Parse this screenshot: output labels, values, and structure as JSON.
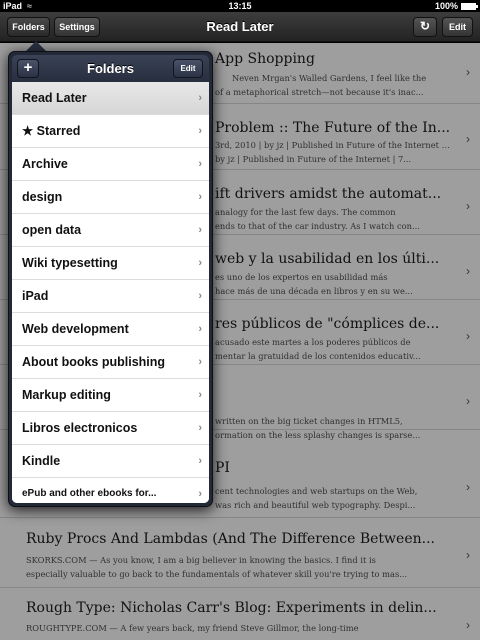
{
  "status": {
    "carrier": "iPad",
    "time": "13:15",
    "battery": "100%"
  },
  "nav": {
    "folders": "Folders",
    "settings": "Settings",
    "title": "Read Later",
    "refresh_icon": "↻",
    "edit": "Edit"
  },
  "articles": [
    {
      "title": "App Shopping",
      "line1": "Neven Mrgan's Walled Gardens, I feel like the",
      "line2": "of a metaphorical stretch—not because it's inac..."
    },
    {
      "title": "Problem :: The Future of the In...",
      "line1": "3rd, 2010 | by jz | Published in Future of the Internet | 5...",
      "line2": "by jz | Published in Future of the Internet | 7..."
    },
    {
      "title": "ift drivers amidst the automat...",
      "line1": "analogy for the last few days. The common",
      "line2": "ends to that of the car industry. As I watch con..."
    },
    {
      "title": "web y la usabilidad en los últi...",
      "line1": "es uno de los expertos en usabilidad más",
      "line2": "hace más de una década en libros y en su we..."
    },
    {
      "title": "res públicos de \"cómplices de...",
      "line1": "acusado este martes a los poderes públicos de",
      "line2": "mentar la gratuidad de los contenidos educativ..."
    },
    {
      "title": "",
      "line1": "written on the big ticket changes in HTML5,",
      "line2": "ormation on the less splashy changes is sparse..."
    },
    {
      "title": "PI",
      "line1": "cent technologies and web startups on the Web,",
      "line2": "was rich and beautiful web typography. Despi..."
    },
    {
      "title": "Ruby Procs And Lambdas (And The Difference Between...",
      "line1": "SKORKS.COM — As you know, I am a big believer in knowing the basics. I find it is",
      "line2": "especially valuable to go back to the fundamentals of whatever skill you're trying to mas..."
    },
    {
      "title": "Rough Type: Nicholas Carr's Blog: Experiments in delin...",
      "line1": "ROUGHTYPE.COM — A few years back, my friend Steve Gillmor, the long-time",
      "line2": ""
    }
  ],
  "popover": {
    "add": "+",
    "title": "Folders",
    "edit": "Edit",
    "chevron": "›",
    "folders": [
      "Read Later",
      "★ Starred",
      "Archive",
      "design",
      "open data",
      "Wiki typesetting",
      "iPad",
      "Web development",
      "About books publishing",
      "Markup editing",
      "Libros electronicos",
      "Kindle",
      "ePub and other ebooks for..."
    ]
  }
}
